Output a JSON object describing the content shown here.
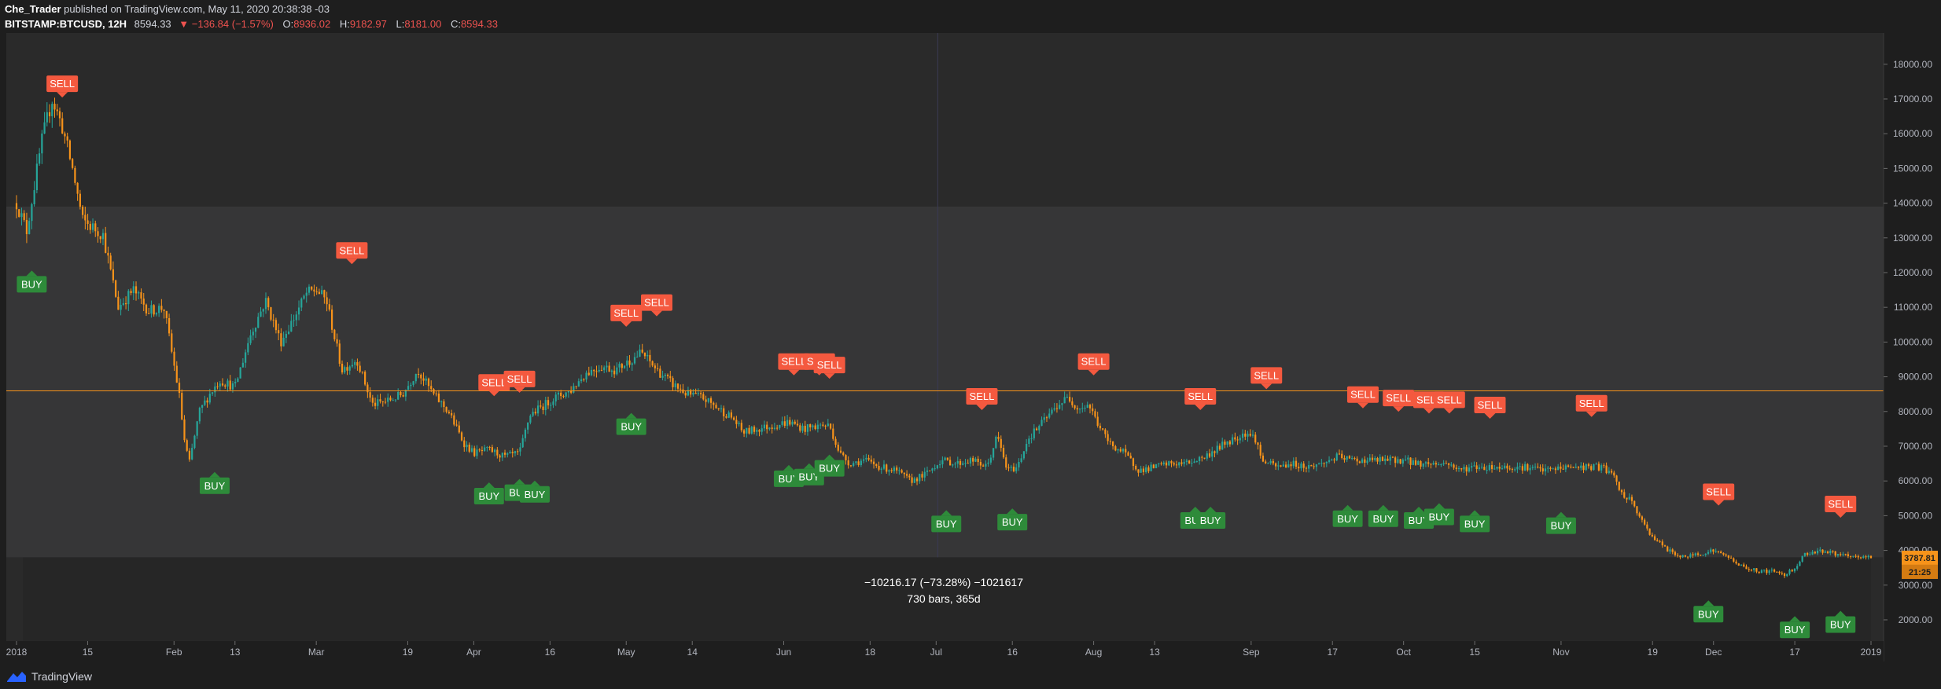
{
  "header": {
    "author": "Che_Trader",
    "published": "published on TradingView.com, May 11, 2020 20:38:38 -03",
    "symbol": "BITSTAMP:BTCUSD, 12H",
    "price": "8594.33",
    "change": "▼ −136.84 (−1.57%)",
    "open_label": "O:",
    "open": "8936.02",
    "high_label": "H:",
    "high": "9182.97",
    "low_label": "L:",
    "low": "8181.00",
    "close_label": "C:",
    "close": "8594.33"
  },
  "footer": {
    "brand": "TradingView"
  },
  "colors": {
    "background": "#1e1e1e",
    "plot": "#2a2a2a",
    "band": "#363637",
    "candle_up": "#26a69a",
    "candle_down": "#f7931a",
    "buy": "#2e8b3a",
    "sell": "#f4593f",
    "price_line": "#f7931a",
    "axis_text": "#b2b5be"
  },
  "chart_data": {
    "type": "candlestick",
    "symbol": "BITSTAMP:BTCUSD",
    "interval": "12H",
    "ylim": [
      1400,
      18900
    ],
    "y_ticks": [
      "2000.00",
      "3000.00",
      "4000.00",
      "5000.00",
      "6000.00",
      "7000.00",
      "8000.00",
      "9000.00",
      "10000.00",
      "11000.00",
      "12000.00",
      "13000.00",
      "14000.00",
      "15000.00",
      "16000.00",
      "17000.00",
      "18000.00"
    ],
    "x_ticks": [
      {
        "t": 0,
        "label": "2018"
      },
      {
        "t": 14,
        "label": "15"
      },
      {
        "t": 31,
        "label": "Feb"
      },
      {
        "t": 43,
        "label": "13"
      },
      {
        "t": 59,
        "label": "Mar"
      },
      {
        "t": 77,
        "label": "19"
      },
      {
        "t": 90,
        "label": "Apr"
      },
      {
        "t": 105,
        "label": "16"
      },
      {
        "t": 120,
        "label": "May"
      },
      {
        "t": 133,
        "label": "14"
      },
      {
        "t": 151,
        "label": "Jun"
      },
      {
        "t": 168,
        "label": "18"
      },
      {
        "t": 181,
        "label": "Jul"
      },
      {
        "t": 196,
        "label": "16"
      },
      {
        "t": 212,
        "label": "Aug"
      },
      {
        "t": 224,
        "label": "13"
      },
      {
        "t": 243,
        "label": "Sep"
      },
      {
        "t": 259,
        "label": "17"
      },
      {
        "t": 273,
        "label": "Oct"
      },
      {
        "t": 287,
        "label": "15"
      },
      {
        "t": 304,
        "label": "Nov"
      },
      {
        "t": 322,
        "label": "19"
      },
      {
        "t": 334,
        "label": "Dec"
      },
      {
        "t": 350,
        "label": "17"
      },
      {
        "t": 365,
        "label": "2019"
      }
    ],
    "price_path": [
      [
        0,
        14000
      ],
      [
        2,
        13200
      ],
      [
        5,
        15800
      ],
      [
        7,
        17000
      ],
      [
        9,
        16200
      ],
      [
        11,
        15000
      ],
      [
        13,
        13500
      ],
      [
        17,
        13100
      ],
      [
        20,
        11000
      ],
      [
        23,
        11500
      ],
      [
        26,
        10900
      ],
      [
        29,
        11000
      ],
      [
        32,
        8500
      ],
      [
        33,
        7200
      ],
      [
        34,
        6500
      ],
      [
        36,
        8000
      ],
      [
        38,
        8500
      ],
      [
        40,
        8900
      ],
      [
        43,
        8700
      ],
      [
        46,
        10200
      ],
      [
        49,
        11200
      ],
      [
        52,
        10000
      ],
      [
        55,
        10800
      ],
      [
        57,
        11400
      ],
      [
        59,
        11500
      ],
      [
        61,
        11200
      ],
      [
        64,
        9200
      ],
      [
        67,
        9500
      ],
      [
        70,
        8200
      ],
      [
        73,
        8300
      ],
      [
        76,
        8500
      ],
      [
        79,
        9200
      ],
      [
        82,
        8500
      ],
      [
        85,
        8000
      ],
      [
        88,
        7100
      ],
      [
        90,
        6800
      ],
      [
        93,
        6900
      ],
      [
        96,
        6700
      ],
      [
        99,
        6800
      ],
      [
        101,
        7900
      ],
      [
        104,
        8200
      ],
      [
        106,
        8400
      ],
      [
        109,
        8600
      ],
      [
        112,
        9100
      ],
      [
        115,
        9300
      ],
      [
        118,
        9200
      ],
      [
        121,
        9500
      ],
      [
        123,
        9700
      ],
      [
        126,
        9200
      ],
      [
        129,
        8800
      ],
      [
        132,
        8500
      ],
      [
        135,
        8400
      ],
      [
        138,
        8100
      ],
      [
        141,
        7800
      ],
      [
        143,
        7400
      ],
      [
        146,
        7500
      ],
      [
        149,
        7600
      ],
      [
        152,
        7700
      ],
      [
        155,
        7500
      ],
      [
        158,
        7600
      ],
      [
        160,
        7600
      ],
      [
        162,
        6800
      ],
      [
        164,
        6500
      ],
      [
        167,
        6600
      ],
      [
        170,
        6400
      ],
      [
        173,
        6300
      ],
      [
        176,
        6000
      ],
      [
        179,
        6200
      ],
      [
        182,
        6600
      ],
      [
        185,
        6500
      ],
      [
        188,
        6600
      ],
      [
        191,
        6400
      ],
      [
        193,
        7300
      ],
      [
        195,
        6300
      ],
      [
        197,
        6400
      ],
      [
        199,
        7200
      ],
      [
        202,
        7700
      ],
      [
        205,
        8200
      ],
      [
        207,
        8400
      ],
      [
        209,
        8100
      ],
      [
        211,
        8200
      ],
      [
        213,
        7600
      ],
      [
        215,
        7100
      ],
      [
        218,
        6800
      ],
      [
        221,
        6300
      ],
      [
        224,
        6400
      ],
      [
        227,
        6500
      ],
      [
        230,
        6500
      ],
      [
        234,
        6700
      ],
      [
        238,
        7100
      ],
      [
        242,
        7400
      ],
      [
        244,
        7200
      ],
      [
        245,
        6600
      ],
      [
        248,
        6400
      ],
      [
        251,
        6500
      ],
      [
        254,
        6400
      ],
      [
        257,
        6500
      ],
      [
        260,
        6700
      ],
      [
        263,
        6600
      ],
      [
        266,
        6600
      ],
      [
        270,
        6600
      ],
      [
        273,
        6600
      ],
      [
        276,
        6500
      ],
      [
        279,
        6500
      ],
      [
        282,
        6500
      ],
      [
        284,
        6300
      ],
      [
        286,
        6400
      ],
      [
        289,
        6400
      ],
      [
        293,
        6400
      ],
      [
        297,
        6400
      ],
      [
        301,
        6300
      ],
      [
        305,
        6400
      ],
      [
        309,
        6400
      ],
      [
        312,
        6400
      ],
      [
        314,
        6200
      ],
      [
        316,
        5600
      ],
      [
        318,
        5400
      ],
      [
        320,
        4800
      ],
      [
        322,
        4400
      ],
      [
        325,
        4000
      ],
      [
        328,
        3800
      ],
      [
        331,
        3900
      ],
      [
        334,
        4000
      ],
      [
        337,
        3800
      ],
      [
        340,
        3500
      ],
      [
        343,
        3400
      ],
      [
        346,
        3400
      ],
      [
        348,
        3300
      ],
      [
        350,
        3500
      ],
      [
        352,
        3900
      ],
      [
        355,
        4000
      ],
      [
        358,
        3900
      ],
      [
        361,
        3800
      ],
      [
        365,
        3800
      ]
    ],
    "price_line": 8594.33,
    "last_price_tag": "3787.81",
    "countdown_tag": "21:25",
    "band": {
      "top": 13900,
      "bottom": 3800
    },
    "signals": [
      {
        "type": "BUY",
        "t": 3,
        "y": 11900
      },
      {
        "type": "SELL",
        "t": 9,
        "y": 17200
      },
      {
        "type": "BUY",
        "t": 39,
        "y": 6100
      },
      {
        "type": "SELL",
        "t": 66,
        "y": 12400
      },
      {
        "type": "SELL",
        "t": 94,
        "y": 8600
      },
      {
        "type": "SELL",
        "t": 99,
        "y": 8700
      },
      {
        "type": "BUY",
        "t": 93,
        "y": 5800
      },
      {
        "type": "BUY",
        "t": 99,
        "y": 5900
      },
      {
        "type": "BUY",
        "t": 102,
        "y": 5850
      },
      {
        "type": "SELL",
        "t": 120,
        "y": 10600
      },
      {
        "type": "SELL",
        "t": 126,
        "y": 10900
      },
      {
        "type": "BUY",
        "t": 121,
        "y": 7800
      },
      {
        "type": "SELL",
        "t": 153,
        "y": 9200
      },
      {
        "type": "SELL",
        "t": 158,
        "y": 9200
      },
      {
        "type": "SELL",
        "t": 160,
        "y": 9100
      },
      {
        "type": "BUY",
        "t": 152,
        "y": 6300
      },
      {
        "type": "BUY",
        "t": 156,
        "y": 6350
      },
      {
        "type": "BUY",
        "t": 160,
        "y": 6600
      },
      {
        "type": "BUY",
        "t": 183,
        "y": 5000
      },
      {
        "type": "SELL",
        "t": 190,
        "y": 8200
      },
      {
        "type": "BUY",
        "t": 196,
        "y": 5050
      },
      {
        "type": "SELL",
        "t": 212,
        "y": 9200
      },
      {
        "type": "SELL",
        "t": 233,
        "y": 8200
      },
      {
        "type": "BUY",
        "t": 232,
        "y": 5100
      },
      {
        "type": "BUY",
        "t": 235,
        "y": 5100
      },
      {
        "type": "SELL",
        "t": 246,
        "y": 8800
      },
      {
        "type": "SELL",
        "t": 265,
        "y": 8250
      },
      {
        "type": "BUY",
        "t": 262,
        "y": 5150
      },
      {
        "type": "SELL",
        "t": 272,
        "y": 8150
      },
      {
        "type": "BUY",
        "t": 269,
        "y": 5150
      },
      {
        "type": "SELL",
        "t": 278,
        "y": 8100
      },
      {
        "type": "SELL",
        "t": 282,
        "y": 8100
      },
      {
        "type": "BUY",
        "t": 276,
        "y": 5100
      },
      {
        "type": "BUY",
        "t": 280,
        "y": 5200
      },
      {
        "type": "BUY",
        "t": 287,
        "y": 5000
      },
      {
        "type": "SELL",
        "t": 290,
        "y": 7950
      },
      {
        "type": "BUY",
        "t": 304,
        "y": 4950
      },
      {
        "type": "SELL",
        "t": 310,
        "y": 8000
      },
      {
        "type": "SELL",
        "t": 335,
        "y": 5450
      },
      {
        "type": "BUY",
        "t": 333,
        "y": 2400
      },
      {
        "type": "BUY",
        "t": 350,
        "y": 1950
      },
      {
        "type": "SELL",
        "t": 359,
        "y": 5100
      },
      {
        "type": "BUY",
        "t": 359,
        "y": 2100
      }
    ],
    "measurement": {
      "line1": "−10216.17 (−73.28%) −1021617",
      "line2": "730 bars, 365d",
      "t_start": 0,
      "t_end": 365,
      "y_top": 3800,
      "y_bottom": 1400
    }
  }
}
